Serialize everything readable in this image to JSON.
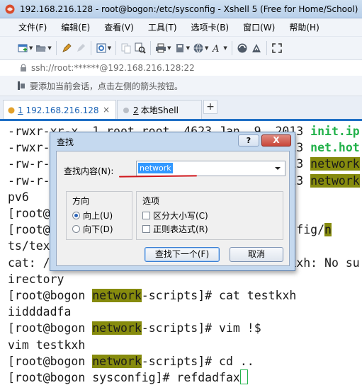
{
  "window": {
    "title": "192.168.216.128 - root@bogon:/etc/sysconfig - Xshell 5 (Free for Home/School)",
    "logo_icon": "xshell-logo-icon"
  },
  "menu": {
    "items": [
      "文件(F)",
      "编辑(E)",
      "查看(V)",
      "工具(T)",
      "选项卡(B)",
      "窗口(W)",
      "帮助(H)"
    ]
  },
  "toolbar": {
    "icons": [
      "new-session-icon",
      "open-folder-icon",
      "edit-pen-icon",
      "disconnect-icon",
      "properties-icon",
      "copy-icon",
      "find-icon",
      "print-icon",
      "transfer-icon",
      "globe-icon",
      "font-icon",
      "xftp-icon",
      "xshell-icon",
      "fullscreen-icon"
    ]
  },
  "address": {
    "text": "ssh://root:******@192.168.216.128:22"
  },
  "hint": {
    "text": "要添加当前会话，点击左侧的箭头按钮。"
  },
  "tabs": {
    "active": {
      "number": "1",
      "label": "192.168.216.128"
    },
    "inactive": {
      "number": "2",
      "label": "本地Shell"
    },
    "add_label": "+"
  },
  "terminal": {
    "lines": [
      {
        "segments": [
          {
            "t": "-rwxr-xr-x. 1 root root  4623 Jan  9  2013 ",
            "c": ""
          },
          {
            "t": "init.ip",
            "c": "green"
          }
        ]
      },
      {
        "segments": [
          {
            "t": "-rwxr-xr-x. 1 root root  8825 Jan  9  2013 ",
            "c": ""
          },
          {
            "t": "net.hot",
            "c": "green"
          }
        ]
      },
      {
        "segments": [
          {
            "t": "-rw-r--r--. 1 root root   335 Jan  9  2013 ",
            "c": ""
          },
          {
            "t": "network",
            "c": "hl"
          }
        ]
      },
      {
        "segments": [
          {
            "t": "-rw-r--r--. 1 root root    82 Jan  9  2013 ",
            "c": ""
          },
          {
            "t": "network",
            "c": "hl"
          }
        ]
      },
      {
        "segments": [
          {
            "t": "pv6",
            "c": ""
          }
        ]
      },
      {
        "segments": [
          {
            "t": "[root@bogon ",
            "c": ""
          }
        ]
      },
      {
        "segments": [
          {
            "t": "[root@bogon ",
            "c": ""
          },
          {
            "t": "                       ",
            "c": ""
          },
          {
            "t": "sysconfig/",
            "c": ""
          },
          {
            "t": "n",
            "c": "hl"
          }
        ]
      },
      {
        "segments": [
          {
            "t": "ts/tex",
            "c": ""
          }
        ]
      },
      {
        "segments": [
          {
            "t": "cat: /etc/sysconfig/network-scripts/testkxh: No su",
            "c": ""
          }
        ]
      },
      {
        "segments": [
          {
            "t": "irectory",
            "c": ""
          }
        ]
      },
      {
        "segments": [
          {
            "t": "[root@bogon ",
            "c": ""
          },
          {
            "t": "network",
            "c": "hl"
          },
          {
            "t": "-scripts]# cat testkxh",
            "c": ""
          }
        ]
      },
      {
        "segments": [
          {
            "t": "iidddadfa",
            "c": ""
          }
        ]
      },
      {
        "segments": [
          {
            "t": "[root@bogon ",
            "c": ""
          },
          {
            "t": "network",
            "c": "hl"
          },
          {
            "t": "-scripts]# vim !$",
            "c": ""
          }
        ]
      },
      {
        "segments": [
          {
            "t": "vim testkxh",
            "c": ""
          }
        ]
      },
      {
        "segments": [
          {
            "t": "[root@bogon ",
            "c": ""
          },
          {
            "t": "network",
            "c": "hl"
          },
          {
            "t": "-scripts]# cd ..",
            "c": ""
          }
        ]
      },
      {
        "segments": [
          {
            "t": "[root@bogon sysconfig]# refdadfax",
            "c": ""
          },
          {
            "t": "",
            "c": "cursor"
          }
        ]
      }
    ]
  },
  "dialog": {
    "title": "查找",
    "help_label": "?",
    "close_label": "X",
    "find_label": "查找内容(N):",
    "find_value": "network",
    "direction": {
      "title": "方向",
      "up": "向上(U)",
      "down": "向下(D)",
      "selected": "up"
    },
    "options": {
      "title": "选项",
      "match_case": "区分大小写(C)",
      "regex": "正则表达式(R)",
      "match_case_checked": false,
      "regex_checked": false
    },
    "find_next_label": "查找下一个(F)",
    "cancel_label": "取消"
  },
  "colors": {
    "highlight": "#868b0d",
    "exec_green": "#23b24b",
    "accent_blue": "#1f6fc5",
    "annotation_red": "#d0161b"
  }
}
